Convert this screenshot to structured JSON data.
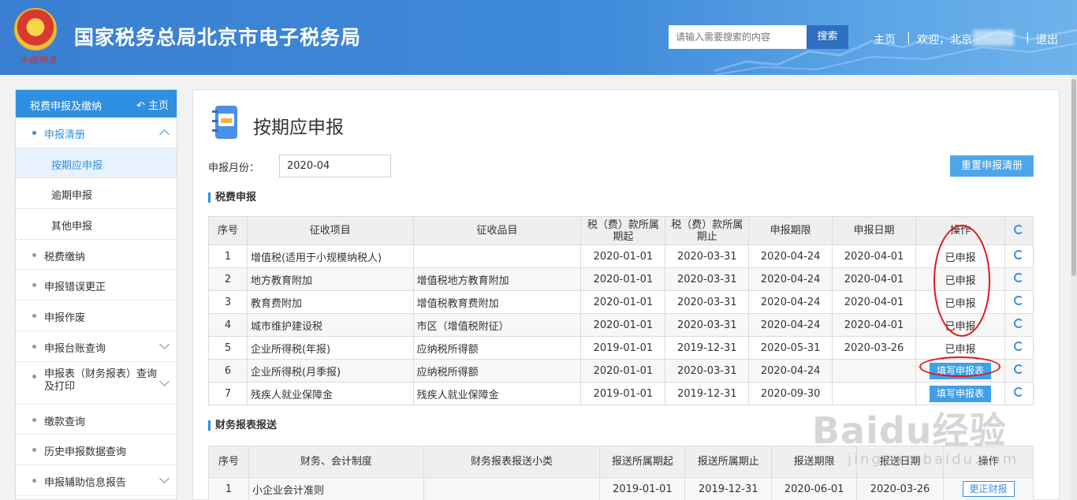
{
  "header": {
    "site_title": "国家税务总局北京市电子税务局",
    "emblem_text": "中国税务",
    "search_placeholder": "请输入需要搜索的内容",
    "search_button": "搜索",
    "nav_home": "主页",
    "separator": "|",
    "welcome": "欢迎，北京",
    "logout": "退出"
  },
  "sidebar": {
    "title": "税费申报及缴纳",
    "home_link": "主页",
    "items": [
      {
        "label": "申报清册"
      },
      {
        "label": "按期应申报"
      },
      {
        "label": "逾期申报"
      },
      {
        "label": "其他申报"
      },
      {
        "label": "税费缴纳"
      },
      {
        "label": "申报错误更正"
      },
      {
        "label": "申报作废"
      },
      {
        "label": "申报台账查询"
      },
      {
        "label": "申报表（财务报表）查询及打印"
      },
      {
        "label": "缴款查询"
      },
      {
        "label": "历史申报数据查询"
      },
      {
        "label": "申报辅助信息报告"
      }
    ]
  },
  "main": {
    "title": "按期应申报",
    "month_label": "申报月份：",
    "month_value": "2020-04",
    "reset_button": "重置申报清册",
    "section1_title": "税费申报",
    "section2_title": "财务报表报送"
  },
  "table1": {
    "headers": [
      "序号",
      "征收项目",
      "征收品目",
      "税（费）款所属期起",
      "税（费）款所属期止",
      "申报期限",
      "申报日期",
      "操作"
    ],
    "rows": [
      {
        "no": "1",
        "item": "增值税(适用于小规模纳税人)",
        "sub": "",
        "start": "2020-01-01",
        "end": "2020-03-31",
        "deadline": "2020-04-24",
        "date": "2020-04-01",
        "op": "已申报"
      },
      {
        "no": "2",
        "item": "地方教育附加",
        "sub": "增值税地方教育附加",
        "start": "2020-01-01",
        "end": "2020-03-31",
        "deadline": "2020-04-24",
        "date": "2020-04-01",
        "op": "已申报"
      },
      {
        "no": "3",
        "item": "教育费附加",
        "sub": "增值税教育费附加",
        "start": "2020-01-01",
        "end": "2020-03-31",
        "deadline": "2020-04-24",
        "date": "2020-04-01",
        "op": "已申报"
      },
      {
        "no": "4",
        "item": "城市维护建设税",
        "sub": "市区（增值税附征）",
        "start": "2020-01-01",
        "end": "2020-03-31",
        "deadline": "2020-04-24",
        "date": "2020-04-01",
        "op": "已申报"
      },
      {
        "no": "5",
        "item": "企业所得税(年报)",
        "sub": "应纳税所得额",
        "start": "2019-01-01",
        "end": "2019-12-31",
        "deadline": "2020-05-31",
        "date": "2020-03-26",
        "op": "已申报"
      },
      {
        "no": "6",
        "item": "企业所得税(月季报)",
        "sub": "应纳税所得额",
        "start": "2020-01-01",
        "end": "2020-03-31",
        "deadline": "2020-04-24",
        "date": "",
        "op": "填写申报表"
      },
      {
        "no": "7",
        "item": "残疾人就业保障金",
        "sub": "残疾人就业保障金",
        "start": "2019-01-01",
        "end": "2019-12-31",
        "deadline": "2020-09-30",
        "date": "",
        "op": "填写申报表"
      }
    ]
  },
  "table2": {
    "headers": [
      "序号",
      "财务、会计制度",
      "财务报表报送小类",
      "报送所属期起",
      "报送所属期止",
      "报送期限",
      "报送日期",
      "操作"
    ],
    "rows": [
      {
        "no": "1",
        "system": "小企业会计准则",
        "category": "",
        "start": "2019-01-01",
        "end": "2019-12-31",
        "deadline": "2020-06-01",
        "date": "2020-03-26",
        "op": "更正财报"
      }
    ]
  },
  "watermark": {
    "logo": "Baidu经验",
    "url": "jingyan.baidu.com"
  },
  "colors": {
    "header_blue": "#3a7fd1",
    "accent": "#2f8fe0",
    "button_blue": "#3f9fe9",
    "annotation_red": "#e01818"
  }
}
